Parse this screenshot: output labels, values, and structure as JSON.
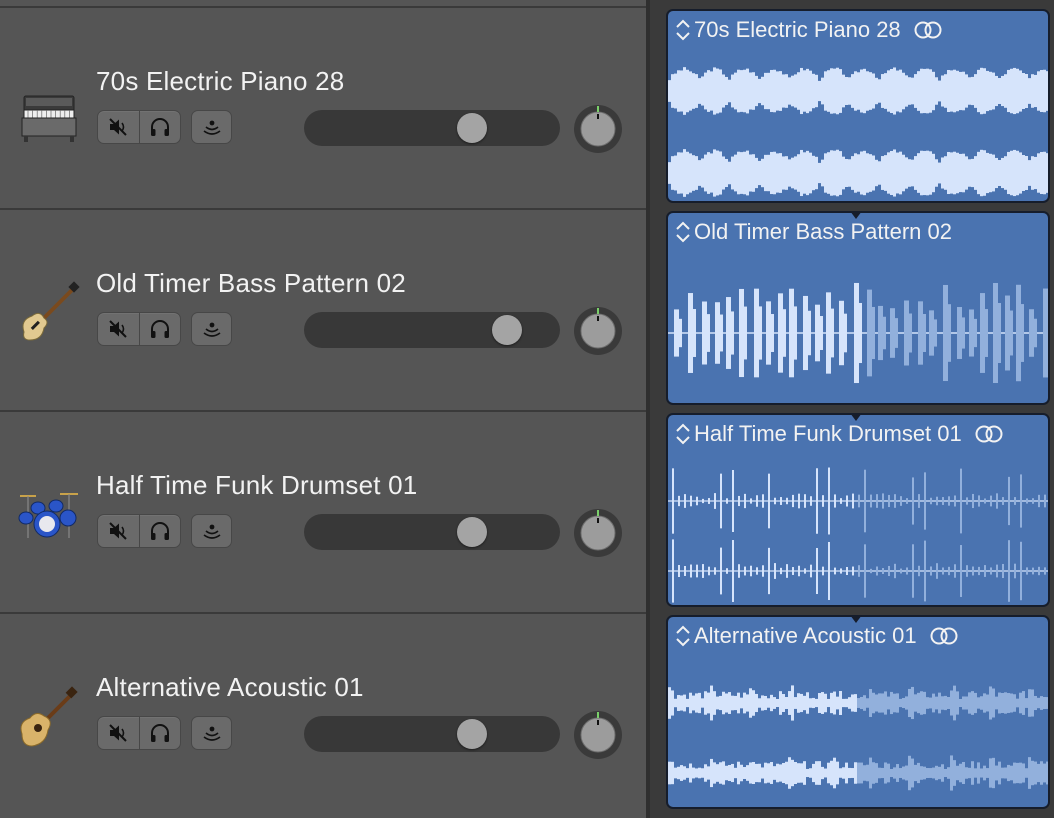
{
  "tracks": [
    {
      "name": "70s Electric Piano 28",
      "instrument_icon": "electric-piano-icon",
      "volume": 0.68,
      "pan": 0,
      "wave": "piano",
      "looped": true
    },
    {
      "name": "Old Timer Bass Pattern 02",
      "instrument_icon": "bass-guitar-icon",
      "volume": 0.84,
      "pan": 0,
      "wave": "bass",
      "looped": false
    },
    {
      "name": "Half Time Funk Drumset 01",
      "instrument_icon": "drum-kit-icon",
      "volume": 0.68,
      "pan": 0,
      "wave": "drums",
      "looped": true
    },
    {
      "name": "Alternative Acoustic 01",
      "instrument_icon": "acoustic-guitar-icon",
      "volume": 0.68,
      "pan": 0,
      "wave": "acoustic",
      "looped": true
    }
  ],
  "controls": {
    "mute_icon": "mute-speaker-icon",
    "solo_icon": "headphones-icon",
    "input_monitor_icon": "input-monitoring-icon",
    "pan_knob_icon": "pan-knob-icon",
    "region_loop_icon": "loop-circles-icon",
    "region_resize_icon": "up-down-chevron-icon"
  },
  "colors": {
    "header_bg": "#555555",
    "region_blue": "#4a73b0",
    "waveform": "#d6e4fb",
    "waveform_loop": "#92b0dc",
    "knob_indicator": "#7ad06a"
  }
}
